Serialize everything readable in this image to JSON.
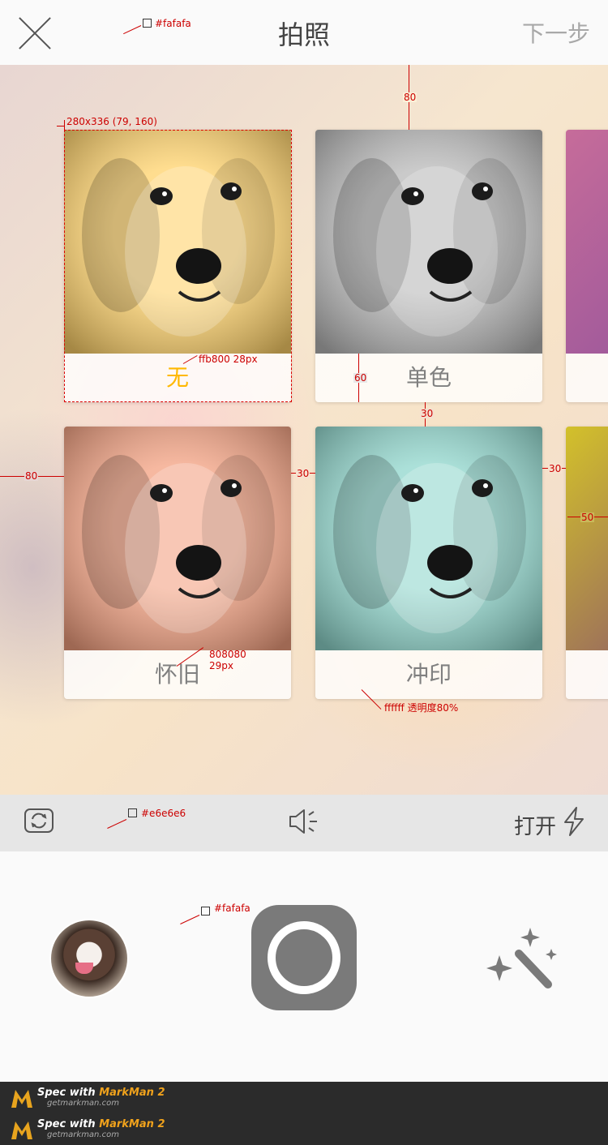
{
  "nav": {
    "title": "拍照",
    "next_label": "下一步"
  },
  "filters": [
    {
      "label": "无",
      "tint": "#ffd26a",
      "active": true
    },
    {
      "label": "单色",
      "tint": "#b8b8b8",
      "active": false
    },
    {
      "label": "怀旧",
      "tint": "#f3a080",
      "active": false
    },
    {
      "label": "冲印",
      "tint": "#8fd6cc",
      "active": false
    }
  ],
  "toolbar": {
    "flash_label": "打开"
  },
  "annotations": {
    "color_top": "#fafafa",
    "card_size": "280x336 (79, 160)",
    "active_caption": "ffb800  28px",
    "gap_top": "80",
    "caption_height": "60",
    "row_gap": "30",
    "left_margin": "80",
    "col_gap_1": "30",
    "col_gap_2": "30",
    "edge": "50",
    "caption_color": "808080",
    "caption_size": "29px",
    "caption_bg": "ffffff  透明度80%",
    "color_toolbar": "#e6e6e6",
    "color_bottom": "#fafafa"
  },
  "footer": {
    "brand_prefix": "Spec with ",
    "brand_name": "MarkMan 2",
    "url": "getmarkman.com"
  },
  "colors": {
    "accent": "#ffb800",
    "caption_text": "#808080",
    "toolbar_bg": "#e6e6e6",
    "nav_bg": "#fafafa"
  }
}
